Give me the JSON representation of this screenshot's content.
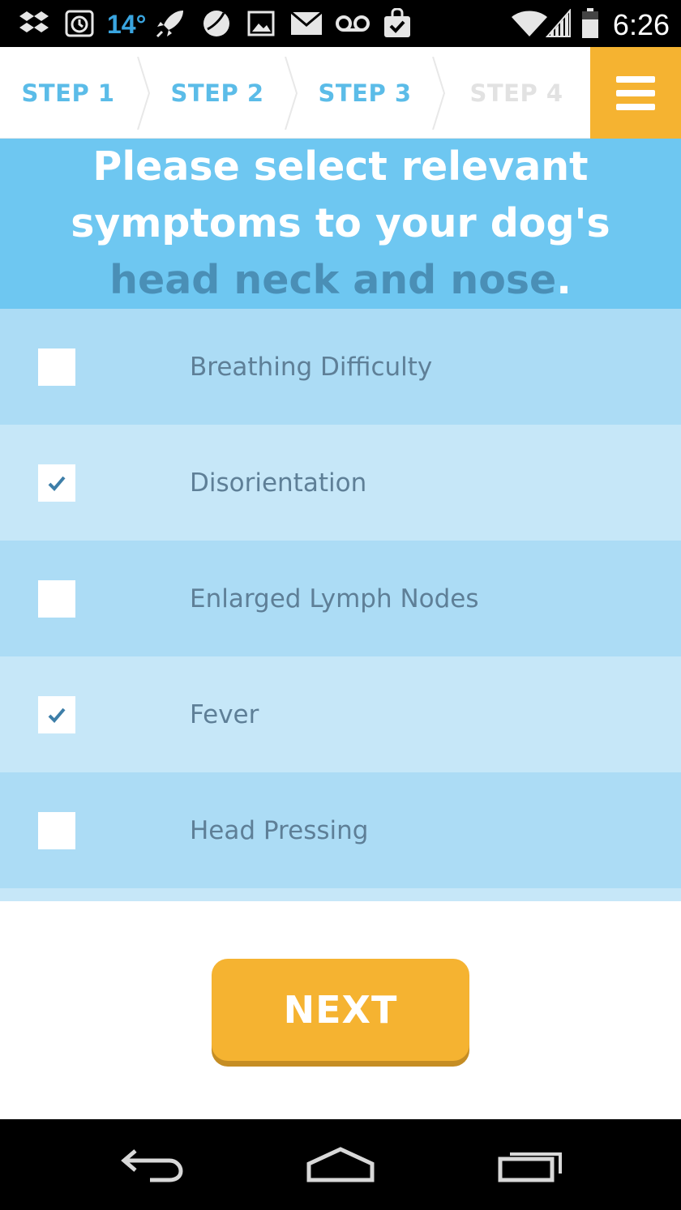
{
  "status_bar": {
    "temperature": "14°",
    "time": "6:26",
    "icons": [
      "dropbox-icon",
      "alarm-icon",
      "rocket-icon",
      "ball-icon",
      "image-icon",
      "mail-icon",
      "voicemail-icon",
      "shopping-bag-icon",
      "wifi-icon",
      "signal-icon",
      "battery-icon"
    ]
  },
  "steps": [
    {
      "label": "STEP 1",
      "state": "active"
    },
    {
      "label": "STEP 2",
      "state": "active"
    },
    {
      "label": "STEP 3",
      "state": "active"
    },
    {
      "label": "STEP 4",
      "state": "inactive"
    }
  ],
  "menu": {
    "icon": "hamburger-menu-icon"
  },
  "title": {
    "line_main": "Please select relevant symptoms to your dog's",
    "line_emphasis": "head neck and nose",
    "period": "."
  },
  "symptoms": [
    {
      "label": "Breathing Difficulty",
      "checked": false
    },
    {
      "label": "Disorientation",
      "checked": true
    },
    {
      "label": "Enlarged Lymph Nodes",
      "checked": false
    },
    {
      "label": "Fever",
      "checked": true
    },
    {
      "label": "Head Pressing",
      "checked": false
    }
  ],
  "next_button": {
    "label": "NEXT"
  },
  "nav_bar": {
    "icons": [
      "back-icon",
      "home-icon",
      "recent-apps-icon"
    ]
  },
  "colors": {
    "accent": "#f5b331",
    "title_band": "#6ec7f1",
    "row_dark": "#acdcf5",
    "row_light": "#c6e7f8",
    "step_active": "#5bbce8",
    "step_inactive": "#e2e2e2",
    "label_text": "#5e7f97",
    "check": "#3d7ea8"
  }
}
